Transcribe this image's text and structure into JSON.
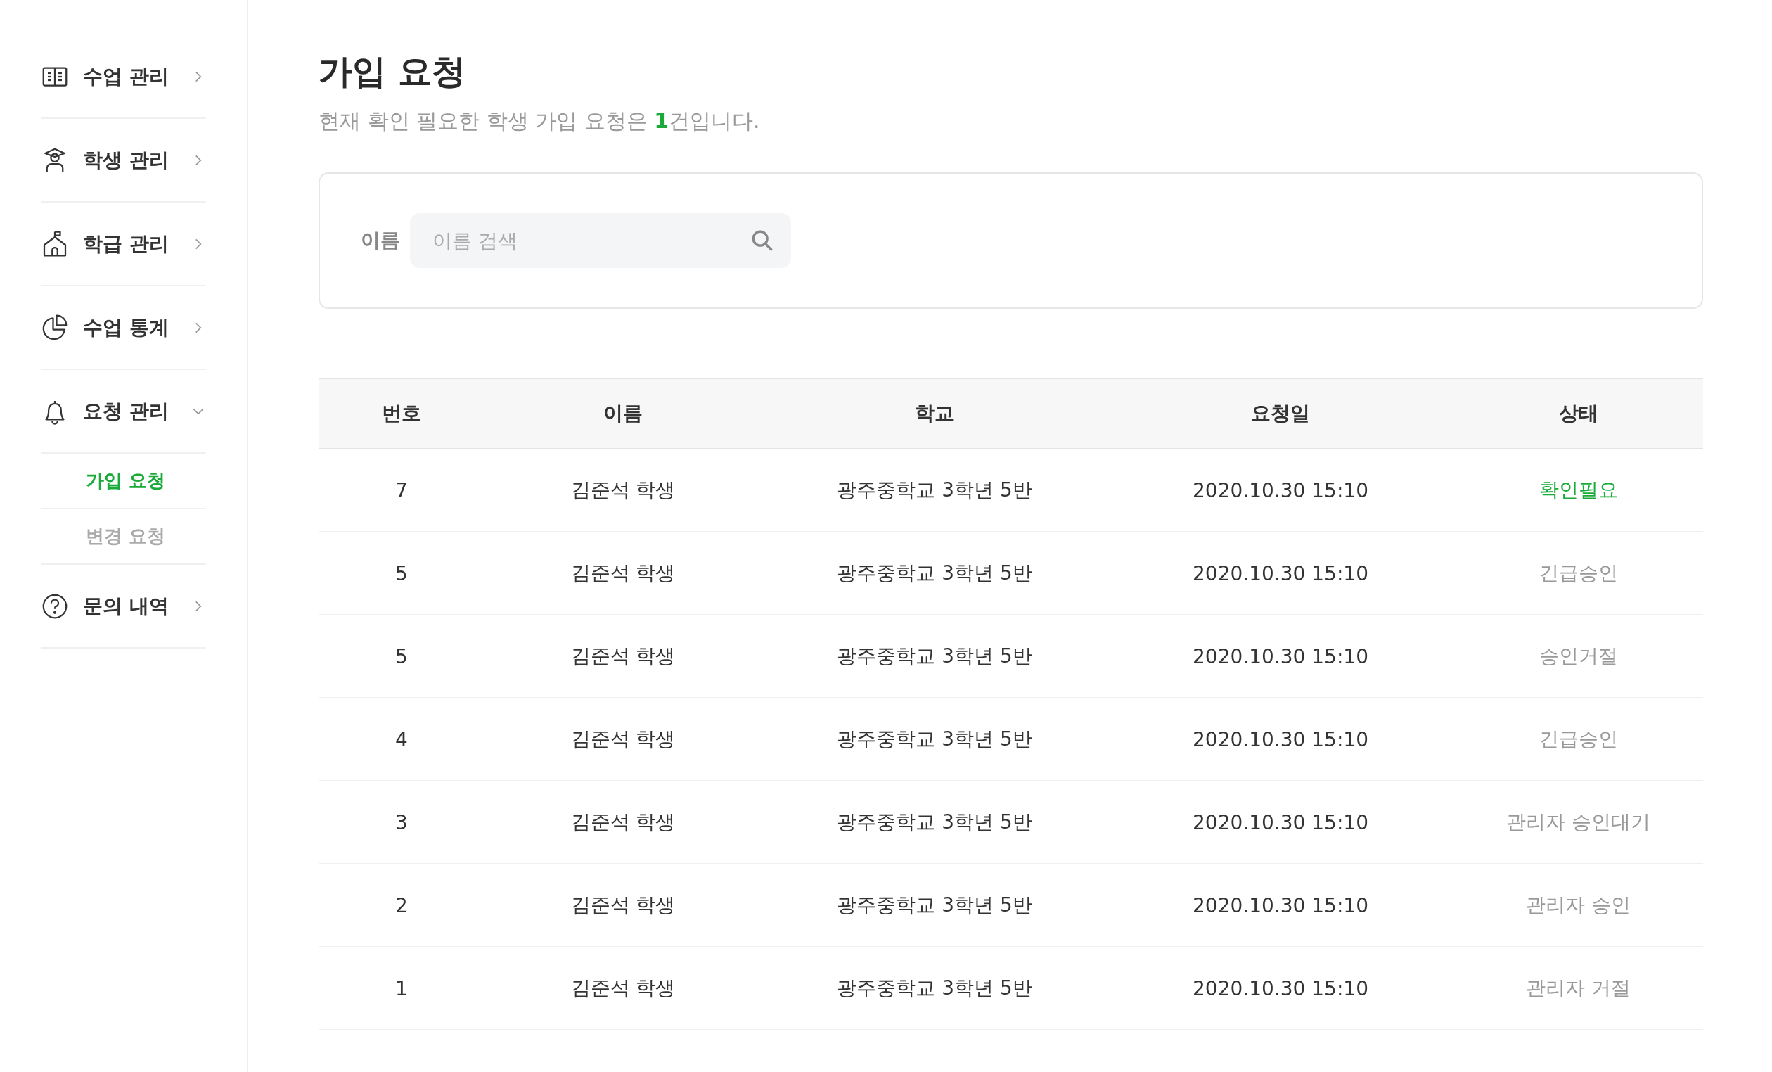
{
  "sidebar": {
    "items": [
      {
        "label": "수업 관리",
        "expanded": false
      },
      {
        "label": "학생 관리",
        "expanded": false
      },
      {
        "label": "학급 관리",
        "expanded": false
      },
      {
        "label": "수업 통계",
        "expanded": false
      },
      {
        "label": "요청 관리",
        "expanded": true,
        "children": [
          {
            "label": "가입 요청",
            "selected": true
          },
          {
            "label": "변경 요청",
            "selected": false
          }
        ]
      },
      {
        "label": "문의 내역",
        "expanded": false
      }
    ]
  },
  "page": {
    "title": "가입 요청",
    "subtitle": "현재 확인 필요한 학생 가입 요청은 **1**건입니다."
  },
  "search": {
    "label": "이름",
    "placeholder": "이름 검색"
  },
  "table": {
    "columns": [
      "번호",
      "이름",
      "학교",
      "요청일",
      "상태"
    ],
    "rows": [
      {
        "cells": [
          "7",
          "김준석 학생",
          "광주중학교 3학년 5반",
          "2020.10.30 15:10"
        ],
        "status": "확인필요",
        "kind": "pending"
      },
      {
        "cells": [
          "5",
          "김준석 학생",
          "광주중학교 3학년 5반",
          "2020.10.30 15:10"
        ],
        "status": "긴급승인",
        "kind": "done"
      },
      {
        "cells": [
          "5",
          "김준석 학생",
          "광주중학교 3학년 5반",
          "2020.10.30 15:10"
        ],
        "status": "승인거절",
        "kind": "done"
      },
      {
        "cells": [
          "4",
          "김준석 학생",
          "광주중학교 3학년 5반",
          "2020.10.30 15:10"
        ],
        "status": "긴급승인",
        "kind": "done"
      },
      {
        "cells": [
          "3",
          "김준석 학생",
          "광주중학교 3학년 5반",
          "2020.10.30 15:10"
        ],
        "status": "관리자 승인대기",
        "kind": "done"
      },
      {
        "cells": [
          "2",
          "김준석 학생",
          "광주중학교 3학년 5반",
          "2020.10.30 15:10"
        ],
        "status": "관리자 승인",
        "kind": "done"
      },
      {
        "cells": [
          "1",
          "김준석 학생",
          "광주중학교 3학년 5반",
          "2020.10.30 15:10"
        ],
        "status": "관리자 거절",
        "kind": "done"
      }
    ]
  }
}
